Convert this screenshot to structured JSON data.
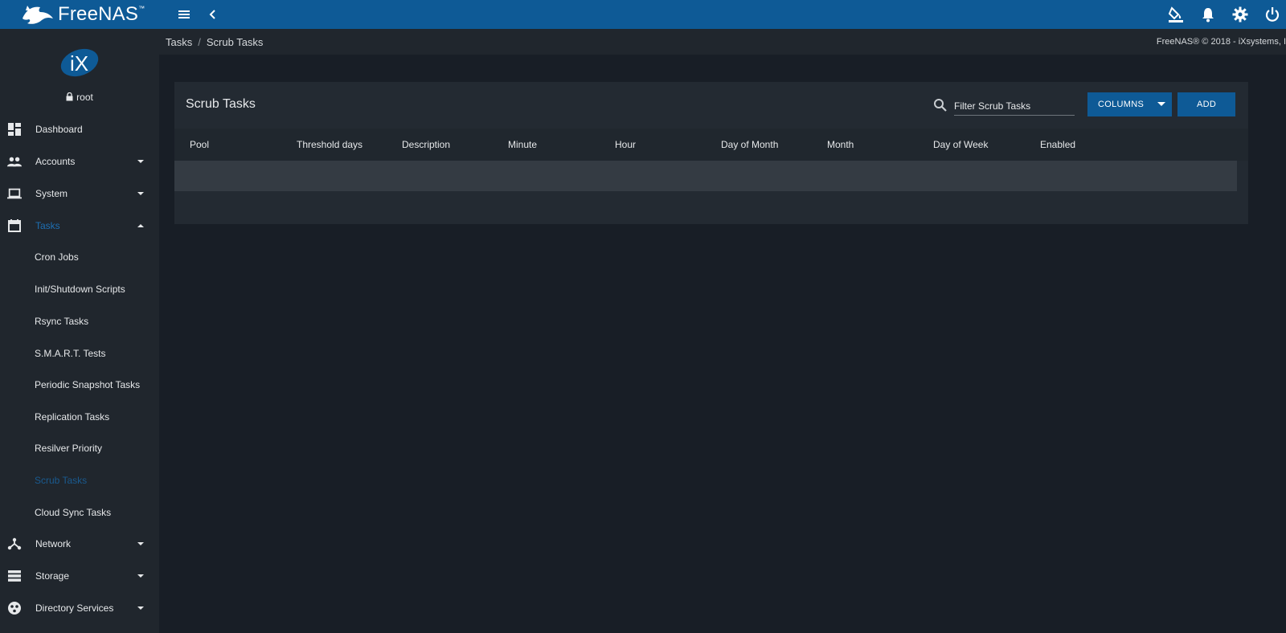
{
  "app": {
    "name": "FreeNAS",
    "trademark": "™"
  },
  "topbar": {
    "menu_icon": "hamburger-menu-icon",
    "back_icon": "chevron-left-icon",
    "actions": [
      "theme-paint-icon",
      "bell-icon",
      "gear-icon",
      "power-icon"
    ]
  },
  "user": {
    "name": "root",
    "logo_text": "iX"
  },
  "breadcrumb": {
    "parent": "Tasks",
    "separator": "/",
    "current": "Scrub Tasks"
  },
  "copyright": "FreeNAS® © 2018 - iXsystems, I",
  "sidebar": {
    "items": [
      {
        "label": "Dashboard",
        "icon": "dashboard-icon"
      },
      {
        "label": "Accounts",
        "icon": "people-icon",
        "expandable": true
      },
      {
        "label": "System",
        "icon": "laptop-icon",
        "expandable": true
      },
      {
        "label": "Tasks",
        "icon": "calendar-icon",
        "expandable": true,
        "expanded": true
      },
      {
        "label": "Network",
        "icon": "network-icon",
        "expandable": true
      },
      {
        "label": "Storage",
        "icon": "storage-icon",
        "expandable": true
      },
      {
        "label": "Directory Services",
        "icon": "directory-icon",
        "expandable": true
      }
    ],
    "task_subitems": [
      "Cron Jobs",
      "Init/Shutdown Scripts",
      "Rsync Tasks",
      "S.M.A.R.T. Tests",
      "Periodic Snapshot Tasks",
      "Replication Tasks",
      "Resilver Priority",
      "Scrub Tasks",
      "Cloud Sync Tasks"
    ],
    "active_subitem": "Scrub Tasks"
  },
  "card": {
    "title": "Scrub Tasks",
    "filter_placeholder": "Filter Scrub Tasks",
    "columns_button": "COLUMNS",
    "add_button": "ADD",
    "headers": [
      "Pool",
      "Threshold days",
      "Description",
      "Minute",
      "Hour",
      "Day of Month",
      "Month",
      "Day of Week",
      "Enabled"
    ],
    "rows": []
  },
  "colors": {
    "topbar": "#0e5a96",
    "sidebar": "#20262d",
    "background": "#181e26",
    "accent": "#1e6fb3"
  }
}
